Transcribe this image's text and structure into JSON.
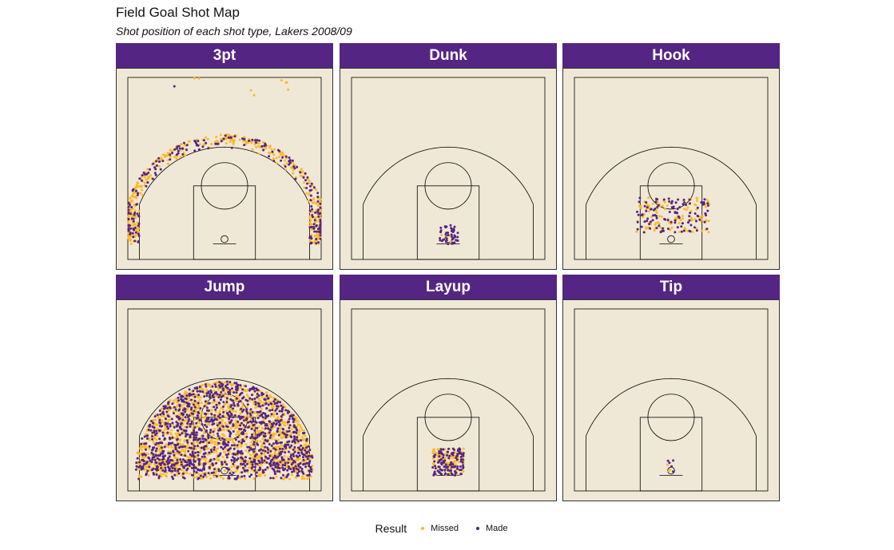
{
  "chart_data": {
    "type": "scatter",
    "title": "Field Goal Shot Map",
    "subtitle": "Shot position of each shot type, Lakers 2008/09",
    "legend": {
      "title": "Result",
      "position": "bottom"
    },
    "colors": {
      "Missed": "#fdb927",
      "Made": "#552583",
      "strip": "#552583",
      "court": "#f0e8d6"
    },
    "court": {
      "xlim": [
        0,
        50
      ],
      "ylim": [
        0,
        47
      ],
      "hoop": [
        25,
        5.25
      ]
    },
    "panels": [
      {
        "name": "3pt",
        "clusters": [
          {
            "shape": "arc",
            "r": [
              23.5,
              27
            ],
            "theta": [
              0,
              180
            ],
            "made": 160,
            "missed": 330
          },
          {
            "shape": "box",
            "x": [
              0.3,
              3
            ],
            "y": [
              4,
              13
            ],
            "made": 25,
            "missed": 55
          },
          {
            "shape": "box",
            "x": [
              47,
              49.7
            ],
            "y": [
              4,
              13
            ],
            "made": 25,
            "missed": 55
          },
          {
            "shape": "box",
            "x": [
              8,
              42
            ],
            "y": [
              42,
              47
            ],
            "made": 1,
            "missed": 8
          }
        ]
      },
      {
        "name": "Dunk",
        "clusters": [
          {
            "shape": "box",
            "x": [
              22.5,
              27.5
            ],
            "y": [
              4,
              9
            ],
            "made": 45,
            "missed": 6
          }
        ]
      },
      {
        "name": "Hook",
        "clusters": [
          {
            "shape": "box",
            "x": [
              16,
              35
            ],
            "y": [
              7,
              16
            ],
            "made": 110,
            "missed": 110
          }
        ]
      },
      {
        "name": "Jump",
        "clusters": [
          {
            "shape": "arc",
            "r": [
              2,
              23
            ],
            "theta": [
              0,
              180
            ],
            "made": 1100,
            "missed": 1300
          },
          {
            "shape": "box",
            "x": [
              2,
              48
            ],
            "y": [
              3,
              8
            ],
            "made": 160,
            "missed": 200
          }
        ]
      },
      {
        "name": "Layup",
        "clusters": [
          {
            "shape": "box",
            "x": [
              21,
              29
            ],
            "y": [
              4,
              11
            ],
            "made": 120,
            "missed": 110
          }
        ]
      },
      {
        "name": "Tip",
        "clusters": [
          {
            "shape": "box",
            "x": [
              24,
              26
            ],
            "y": [
              5,
              8
            ],
            "made": 5,
            "missed": 3
          }
        ]
      }
    ]
  },
  "legend_labels": {
    "title": "Result",
    "missed": "Missed",
    "made": "Made"
  }
}
